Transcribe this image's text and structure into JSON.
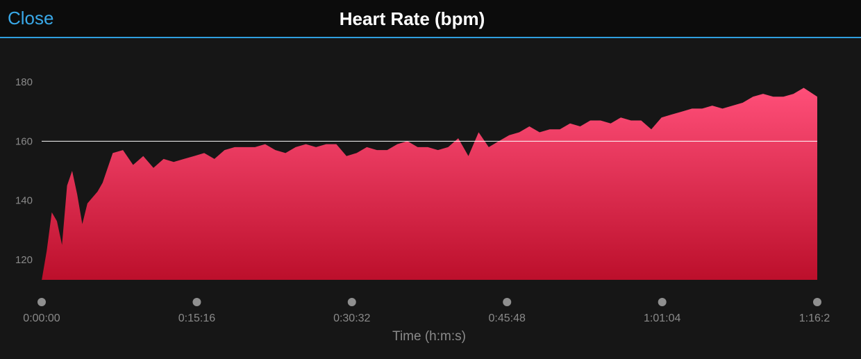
{
  "header": {
    "close_label": "Close",
    "title": "Heart Rate (bpm)"
  },
  "colors": {
    "background": "#161616",
    "header_background": "#0c0c0c",
    "accent": "#39a8e8",
    "area_top": "#ff4f79",
    "area_bottom": "#bc0f2b",
    "reference_line": "#ffffff"
  },
  "chart_data": {
    "type": "area",
    "xlabel": "Time (h:m:s)",
    "ylabel": "",
    "ylim": [
      113,
      186
    ],
    "yticks": [
      120,
      140,
      160,
      180
    ],
    "x_tick_labels": [
      "0:00:00",
      "0:15:16",
      "0:30:32",
      "0:45:48",
      "1:01:04",
      "1:16:2"
    ],
    "x_ticks_minutes": [
      0,
      15.27,
      30.53,
      45.8,
      61.07,
      76.33
    ],
    "xlim_minutes": [
      0,
      76.33
    ],
    "reference_line": 160,
    "x_minutes": [
      0,
      0.5,
      1,
      1.5,
      2,
      2.5,
      3,
      3.5,
      4,
      4.5,
      5,
      5.5,
      6,
      7,
      8,
      9,
      10,
      11,
      12,
      13,
      14,
      15,
      16,
      17,
      18,
      19,
      20,
      21,
      22,
      23,
      24,
      25,
      26,
      27,
      28,
      29,
      30,
      31,
      32,
      33,
      34,
      35,
      36,
      37,
      38,
      39,
      40,
      41,
      42,
      43,
      44,
      45,
      46,
      47,
      48,
      49,
      50,
      51,
      52,
      53,
      54,
      55,
      56,
      57,
      58,
      59,
      60,
      61,
      62,
      63,
      64,
      65,
      66,
      67,
      68,
      69,
      70,
      71,
      72,
      73,
      74,
      75,
      76.33
    ],
    "bpm": [
      113,
      123,
      136,
      133,
      125,
      145,
      150,
      142,
      132,
      139,
      141,
      143,
      146,
      156,
      157,
      152,
      155,
      151,
      154,
      153,
      154,
      155,
      156,
      154,
      157,
      158,
      158,
      158,
      159,
      157,
      156,
      158,
      159,
      158,
      159,
      159,
      155,
      156,
      158,
      157,
      157,
      159,
      160,
      158,
      158,
      157,
      158,
      161,
      155,
      163,
      158,
      160,
      162,
      163,
      165,
      163,
      164,
      164,
      166,
      165,
      167,
      167,
      166,
      168,
      167,
      167,
      164,
      168,
      169,
      170,
      171,
      171,
      172,
      171,
      172,
      173,
      175,
      176,
      175,
      175,
      176,
      178,
      175
    ]
  }
}
